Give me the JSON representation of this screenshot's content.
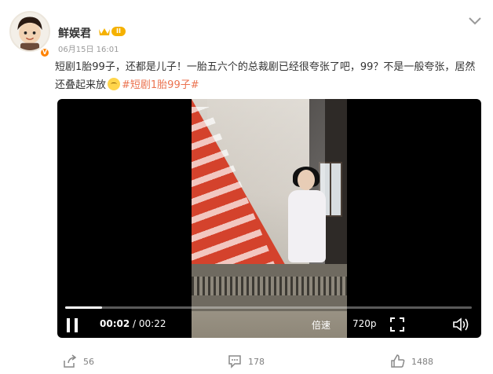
{
  "post": {
    "author": "鲜娱君",
    "level": "II",
    "timestamp": "06月15日 16:01",
    "text_main": "短剧1胎99子，还都是儿子！一胎五六个的总裁剧已经很夸张了吧，99？不是一般夸张，居然还叠起来放",
    "hashtag": "#短剧1胎99子#",
    "emoji": "smirk-emoji"
  },
  "video": {
    "current_time": "00:02",
    "separator": " / ",
    "duration": "00:22",
    "progress": 0.09,
    "speed_label": "倍速",
    "quality_label": "720p"
  },
  "actions": {
    "reposts": "56",
    "comments": "178",
    "likes": "1488"
  },
  "colors": {
    "accent": "#ff8200",
    "hashtag": "#eb7350",
    "badge": "#f5b100"
  },
  "icons": [
    "avatar-badge-icon",
    "crown-icon",
    "chevron-down-icon",
    "pause-icon",
    "fullscreen-icon",
    "volume-icon",
    "repost-icon",
    "comment-icon",
    "like-icon"
  ]
}
